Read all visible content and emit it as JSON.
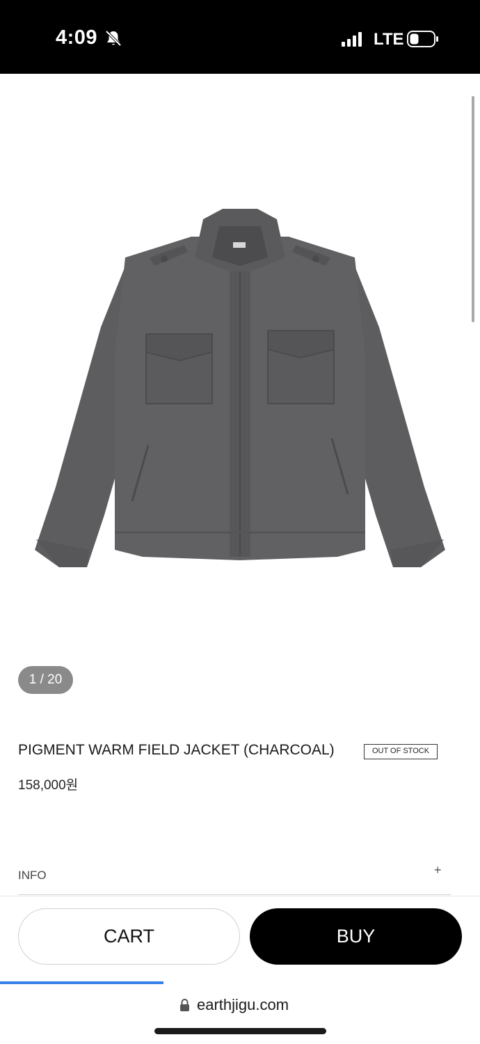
{
  "status_bar": {
    "time": "4:09",
    "network": "LTE",
    "icons": [
      "bell-muted-icon",
      "signal-bars-icon",
      "battery-icon"
    ]
  },
  "gallery": {
    "image": "charcoal-field-jacket-image",
    "counter": "1 / 20"
  },
  "product": {
    "title": "PIGMENT WARM FIELD JACKET (CHARCOAL)",
    "badge": "OUT OF STOCK",
    "price": "158,000원",
    "color": "#5b5b5d"
  },
  "info_section": {
    "label": "INFO",
    "expand_symbol": "+"
  },
  "actions": {
    "cart_label": "CART",
    "buy_label": "BUY"
  },
  "browser": {
    "url": "earthjigu.com",
    "load_progress": 0.34,
    "accent": "#3b82e8"
  }
}
